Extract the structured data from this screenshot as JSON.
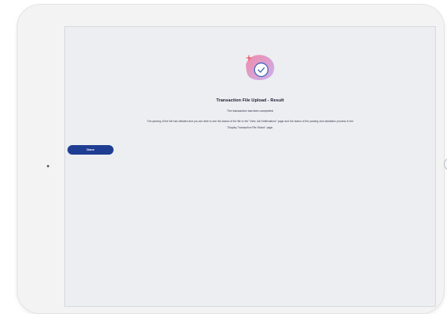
{
  "result": {
    "title": "Transaction File Upload - Result",
    "subtitle": "The transaction has been completed",
    "line1": "The parsing of the file has initiated and you are able to see the status of the file in the \"View Job Notifications\" page and the status of the parsing and validation process in the",
    "line2": "\"Display Transaction File Status\" page.",
    "done_label": "Done"
  },
  "colors": {
    "button": "#1f3d93",
    "hero_blob_left": "#f28aa8",
    "hero_blob_right": "#c8b2f0",
    "check_ring": "#3a5fb5",
    "plus": "#e53b46"
  },
  "icons": {
    "hero": "check-circle-icon",
    "decoration": "plus-icon"
  }
}
